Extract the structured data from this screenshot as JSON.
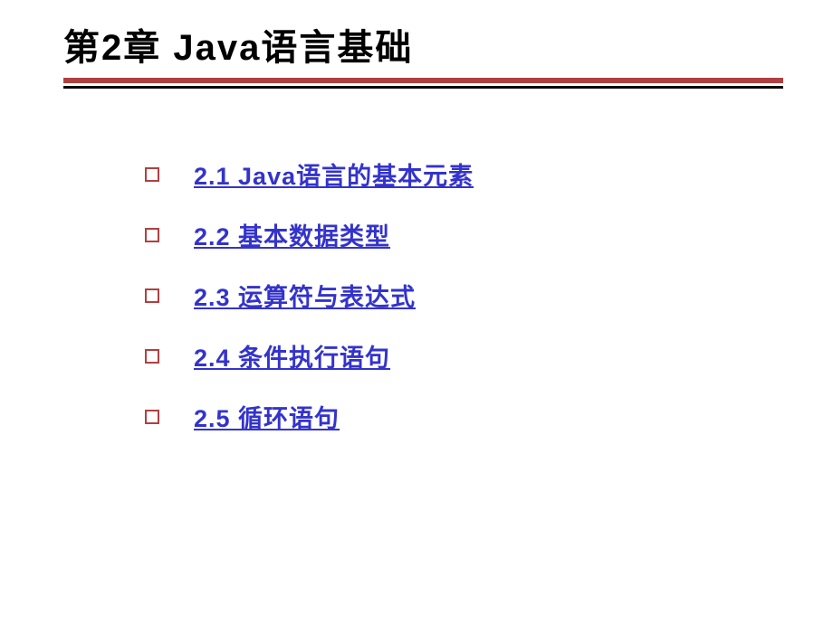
{
  "title": "第2章  Java语言基础",
  "items": [
    {
      "label": "2.1 Java语言的基本元素"
    },
    {
      "label": "2.2 基本数据类型"
    },
    {
      "label": "2.3 运算符与表达式"
    },
    {
      "label": "2.4 条件执行语句"
    },
    {
      "label": "2.5 循环语句"
    }
  ]
}
